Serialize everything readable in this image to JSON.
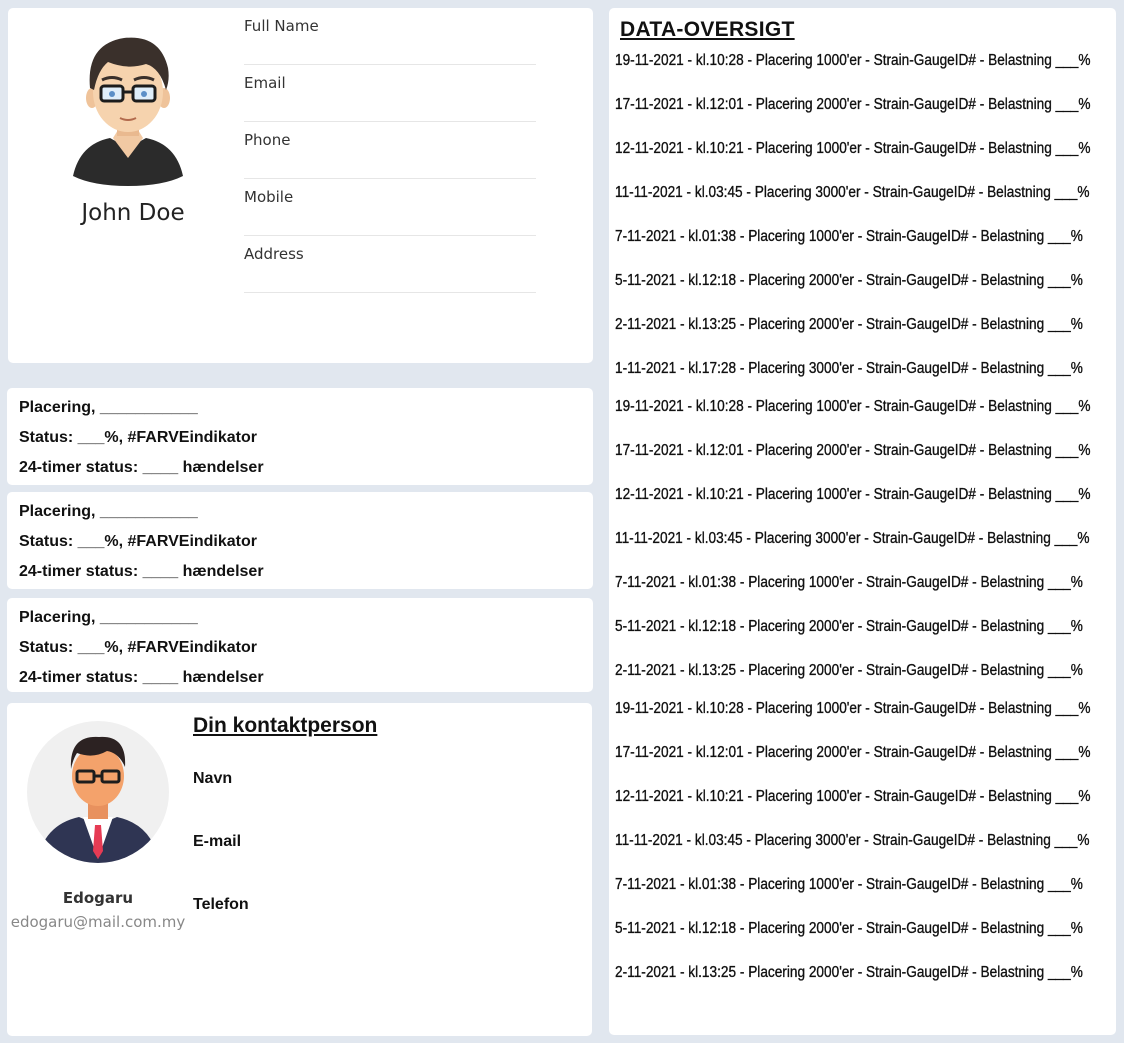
{
  "profile": {
    "name": "John Doe",
    "fields": [
      "Full Name",
      "Email",
      "Phone",
      "Mobile",
      "Address"
    ]
  },
  "status_cards": [
    {
      "placering": "Placering, ___________",
      "status": "Status: ___%, #FARVEindikator",
      "events": "24-timer status: ____  hændelser"
    },
    {
      "placering": "Placering, ___________",
      "status": "Status: ___%, #FARVEindikator",
      "events": "24-timer status: ____  hændelser"
    },
    {
      "placering": "Placering, ___________",
      "status": "Status: ___%, #FARVEindikator",
      "events": "24-timer status: ____  hændelser"
    }
  ],
  "contact": {
    "title": "Din kontaktperson",
    "labels": [
      "Navn",
      "E-mail",
      "Telefon"
    ],
    "name": "Edogaru",
    "email": "edogaru@mail.com.my"
  },
  "data_overview": {
    "title": "DATA-OVERSIGT",
    "entries": [
      "19-11-2021 - kl.10:28 - Placering 1000'er - Strain-GaugeID# - Belastning ___%",
      "17-11-2021 - kl.12:01 - Placering 2000'er - Strain-GaugeID# - Belastning ___%",
      "12-11-2021 - kl.10:21 - Placering 1000'er - Strain-GaugeID# - Belastning ___%",
      "11-11-2021 - kl.03:45 - Placering 3000'er - Strain-GaugeID# - Belastning ___%",
      "7-11-2021 - kl.01:38 - Placering 1000'er - Strain-GaugeID# - Belastning ___%",
      "5-11-2021 - kl.12:18 - Placering 2000'er - Strain-GaugeID# - Belastning ___%",
      "2-11-2021 - kl.13:25 - Placering 2000'er - Strain-GaugeID# - Belastning ___%",
      "1-11-2021 - kl.17:28 - Placering 3000'er - Strain-GaugeID# - Belastning ___%",
      "19-11-2021 - kl.10:28 - Placering 1000'er - Strain-GaugeID# - Belastning ___%",
      "17-11-2021 - kl.12:01 - Placering 2000'er - Strain-GaugeID# - Belastning ___%",
      "12-11-2021 - kl.10:21 - Placering 1000'er - Strain-GaugeID# - Belastning ___%",
      "11-11-2021 - kl.03:45 - Placering 3000'er - Strain-GaugeID# - Belastning ___%",
      "7-11-2021 - kl.01:38 - Placering 1000'er - Strain-GaugeID# - Belastning ___%",
      "5-11-2021 - kl.12:18 - Placering 2000'er - Strain-GaugeID# - Belastning ___%",
      "2-11-2021 - kl.13:25 - Placering 2000'er - Strain-GaugeID# - Belastning ___%",
      "19-11-2021 - kl.10:28 - Placering 1000'er - Strain-GaugeID# - Belastning ___%",
      "17-11-2021 - kl.12:01 - Placering 2000'er - Strain-GaugeID# - Belastning ___%",
      "12-11-2021 - kl.10:21 - Placering 1000'er - Strain-GaugeID# - Belastning ___%",
      "11-11-2021 - kl.03:45 - Placering 3000'er - Strain-GaugeID# - Belastning ___%",
      "7-11-2021 - kl.01:38 - Placering 1000'er - Strain-GaugeID# - Belastning ___%",
      "5-11-2021 - kl.12:18 - Placering 2000'er - Strain-GaugeID# - Belastning ___%",
      "2-11-2021 - kl.13:25 - Placering 2000'er - Strain-GaugeID# - Belastning ___%"
    ]
  }
}
